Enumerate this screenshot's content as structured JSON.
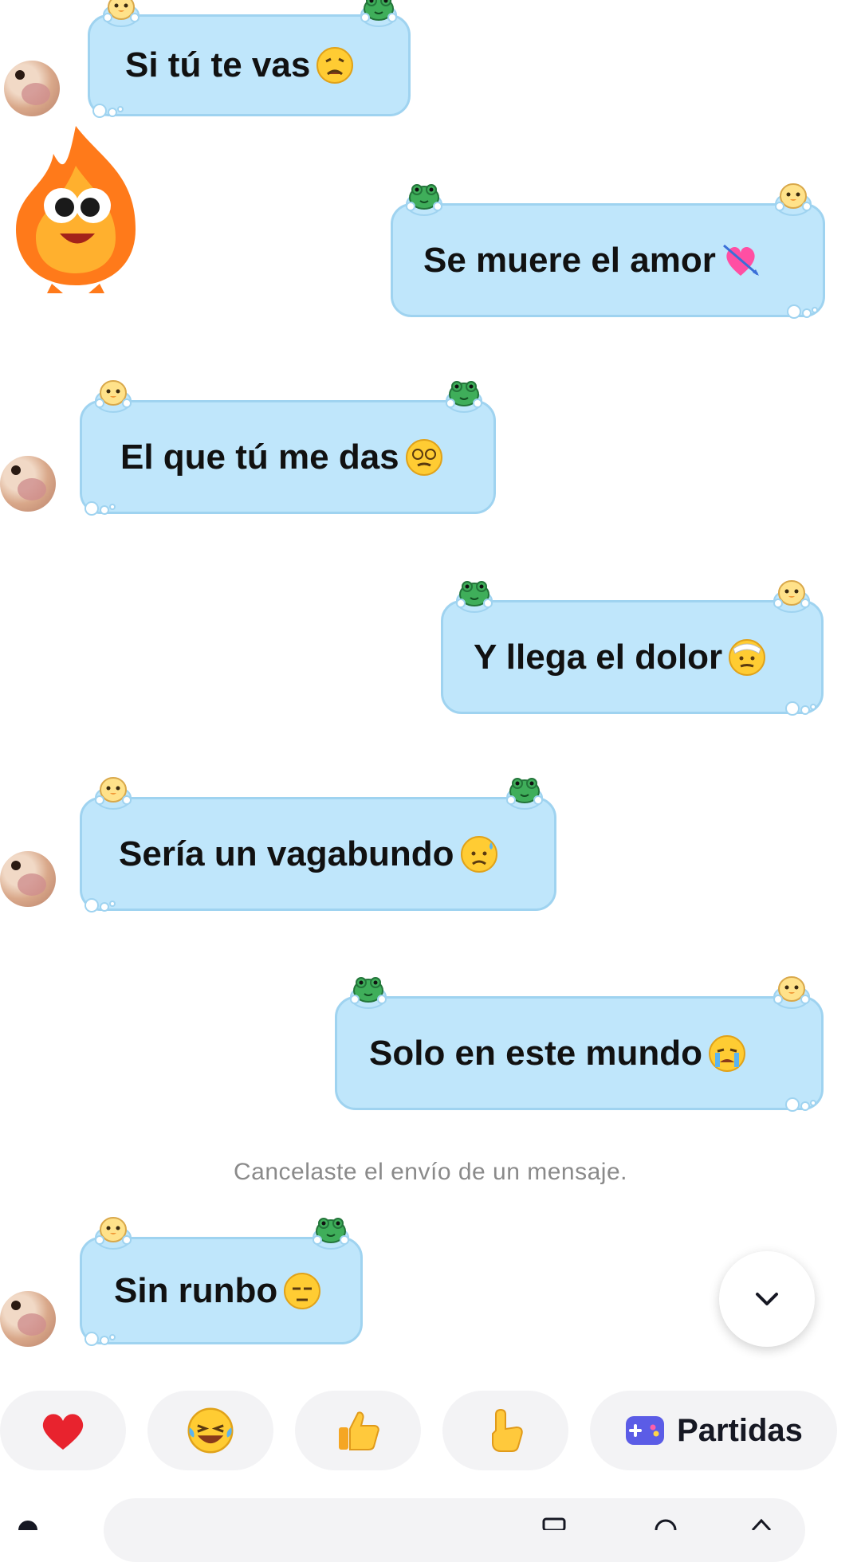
{
  "messages": [
    {
      "side": "left",
      "text": "Si tú te vas",
      "emoji": "weary-face-emoji"
    },
    {
      "side": "right",
      "text": "Se muere el amor",
      "emoji": "heart-with-arrow-emoji"
    },
    {
      "side": "left",
      "text": "El que tú me das",
      "emoji": "dizzy-face-emoji"
    },
    {
      "side": "right",
      "text": "Y llega el dolor",
      "emoji": "bandage-face-emoji"
    },
    {
      "side": "left",
      "text": "Sería un vagabundo",
      "emoji": "sad-sweat-face-emoji"
    },
    {
      "side": "right",
      "text": "Solo en este mundo",
      "emoji": "crying-face-emoji"
    },
    {
      "side": "left",
      "text": "Sin runbo",
      "emoji": "unamused-face-emoji"
    }
  ],
  "system_message": "Cancelaste el envío de un mensaje.",
  "quick_reactions": [
    {
      "icon": "red-heart-icon"
    },
    {
      "icon": "laughing-tears-icon"
    },
    {
      "icon": "thumbs-up-icon"
    },
    {
      "icon": "pointing-hand-icon"
    },
    {
      "icon": "gamepad-icon",
      "label": "Partidas"
    }
  ],
  "colors": {
    "bubble_fill": "#bfe6fb",
    "bubble_border": "#9fd3f0",
    "system_text": "#8a8a8a",
    "reaction_bg": "#f3f3f5",
    "games_icon": "#5b5ce6"
  }
}
